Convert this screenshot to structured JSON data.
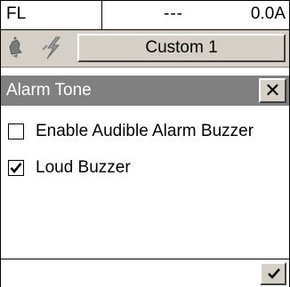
{
  "status": {
    "mode": "FL",
    "value_placeholder": "---",
    "current": "0.0A"
  },
  "toolbar": {
    "icons": [
      "bell-icon",
      "lightning-icon"
    ],
    "profile_button": "Custom 1"
  },
  "dialog": {
    "title": "Alarm Tone",
    "close_glyph": "✕",
    "options": [
      {
        "label": "Enable Audible Alarm Buzzer",
        "checked": false
      },
      {
        "label": "Loud Buzzer",
        "checked": true
      }
    ],
    "confirm_icon": "checkmark-icon"
  }
}
